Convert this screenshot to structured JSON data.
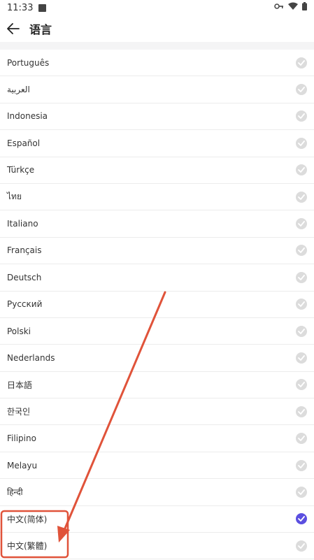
{
  "status_bar": {
    "time": "11:33"
  },
  "header": {
    "title": "语言"
  },
  "languages": [
    {
      "label": "Português",
      "selected": false
    },
    {
      "label": "العربية",
      "selected": false
    },
    {
      "label": "Indonesia",
      "selected": false
    },
    {
      "label": "Español",
      "selected": false
    },
    {
      "label": "Türkçe",
      "selected": false
    },
    {
      "label": "ไทย",
      "selected": false
    },
    {
      "label": "Italiano",
      "selected": false
    },
    {
      "label": "Français",
      "selected": false
    },
    {
      "label": "Deutsch",
      "selected": false
    },
    {
      "label": "Русский",
      "selected": false
    },
    {
      "label": "Polski",
      "selected": false
    },
    {
      "label": "Nederlands",
      "selected": false
    },
    {
      "label": "日本語",
      "selected": false
    },
    {
      "label": "한국인",
      "selected": false
    },
    {
      "label": "Filipino",
      "selected": false
    },
    {
      "label": "Melayu",
      "selected": false
    },
    {
      "label": "हिन्दी",
      "selected": false
    },
    {
      "label": "中文(简体)",
      "selected": true
    },
    {
      "label": "中文(繁體)",
      "selected": false
    }
  ],
  "colors": {
    "accent": "#5b4fe0",
    "check_off": "#dcdcdc",
    "annotation": "#e0533a"
  },
  "icons": [
    "back-arrow-icon",
    "key-icon",
    "wifi-icon",
    "battery-icon",
    "check-icon"
  ]
}
